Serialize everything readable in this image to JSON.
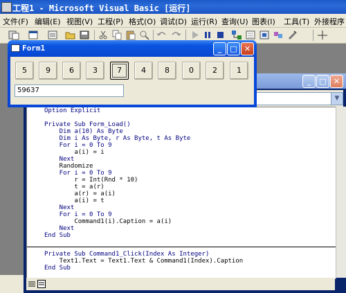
{
  "window": {
    "title": "工程1 - Microsoft Visual Basic [运行]"
  },
  "menu": [
    "文件(F)",
    "编辑(E)",
    "视图(V)",
    "工程(P)",
    "格式(O)",
    "调试(D)",
    "运行(R)",
    "查询(U)",
    "图表(I)",
    "工具(T)",
    "外接程序"
  ],
  "form1": {
    "title": "Form1",
    "buttons": [
      "5",
      "9",
      "6",
      "3",
      "7",
      "4",
      "8",
      "0",
      "2",
      "1"
    ],
    "focused_index": 4,
    "text1_value": "59637"
  },
  "code": {
    "lines": [
      "Option Explicit",
      "",
      "Private Sub Form_Load()",
      "    Dim a(10) As Byte",
      "    Dim i As Byte, r As Byte, t As Byte",
      "    For i = 0 To 9",
      "        a(i) = i",
      "    Next",
      "    Randomize",
      "    For i = 0 To 9",
      "        r = Int(Rnd * 10)",
      "        t = a(r)",
      "        a(r) = a(i)",
      "        a(i) = t",
      "    Next",
      "    For i = 0 To 9",
      "        Command1(i).Caption = a(i)",
      "    Next",
      "End Sub",
      "",
      "Private Sub Command1_Click(Index As Integer)",
      "    Text1.Text = Text1.Text & Command1(Index).Caption",
      "End Sub"
    ]
  },
  "icons": {
    "app": "vb-app-icon",
    "form": "form-icon",
    "minimize": "minimize-icon",
    "maximize": "maximize-icon",
    "close": "close-icon"
  }
}
